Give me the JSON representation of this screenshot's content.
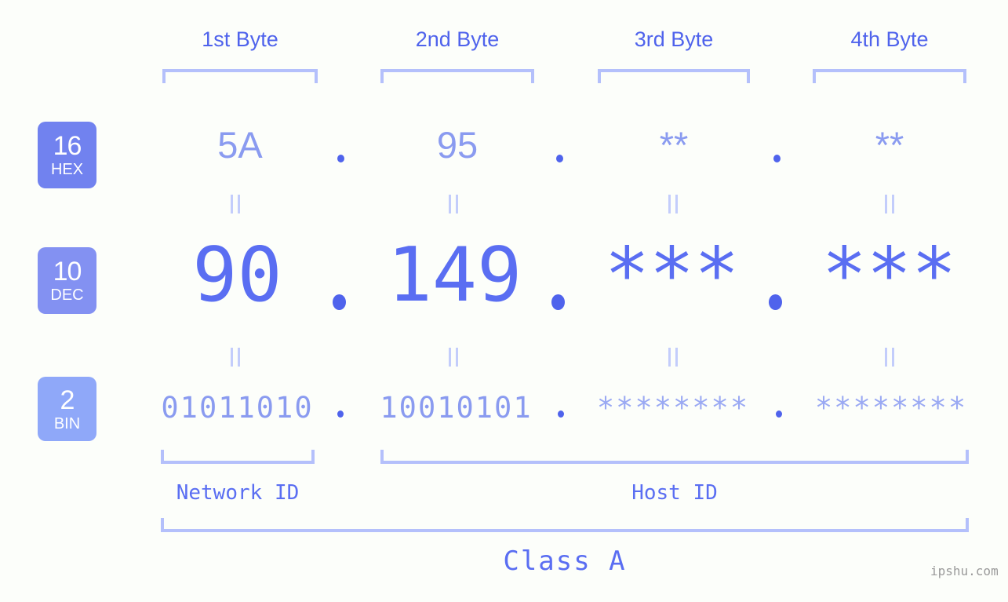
{
  "background_color": "#fcfefa",
  "accent_color": "#5a6ef2",
  "bracket_color": "#b4c0fb",
  "byte_headers": [
    {
      "label": "1st Byte"
    },
    {
      "label": "2nd Byte"
    },
    {
      "label": "3rd Byte"
    },
    {
      "label": "4th Byte"
    }
  ],
  "rows": [
    {
      "base": "16",
      "name": "HEX",
      "badge_color": "#7182ef",
      "values": [
        "5A",
        "95",
        "**",
        "**"
      ],
      "separator": "."
    },
    {
      "base": "10",
      "name": "DEC",
      "badge_color": "#8391f2",
      "values": [
        "90",
        "149",
        "***",
        "***"
      ],
      "separator": "."
    },
    {
      "base": "2",
      "name": "BIN",
      "badge_color": "#8fa8f9",
      "values": [
        "01011010",
        "10010101",
        "********",
        "********"
      ],
      "separator": "."
    }
  ],
  "equals_symbol": "=",
  "id_sections": [
    {
      "label": "Network ID"
    },
    {
      "label": "Host ID"
    }
  ],
  "class_label": "Class A",
  "watermark": "ipshu.com"
}
